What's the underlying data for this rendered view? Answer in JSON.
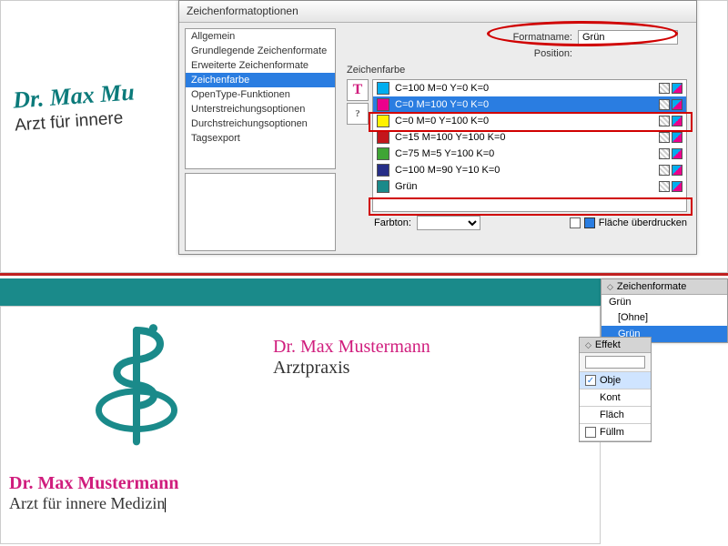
{
  "dialog": {
    "title": "Zeichenformatoptionen",
    "formatname_label": "Formatname:",
    "formatname_value": "Grün",
    "position_label": "Position:",
    "left_items": [
      "Allgemein",
      "Grundlegende Zeichenformate",
      "Erweiterte Zeichenformate",
      "Zeichenfarbe",
      "OpenType-Funktionen",
      "Unterstreichungsoptionen",
      "Durchstreichungsoptionen",
      "Tagsexport"
    ],
    "left_selected_index": 3,
    "right_section_title": "Zeichenfarbe",
    "swatches": [
      {
        "label": "C=100 M=0 Y=0 K=0",
        "color": "#00aeef"
      },
      {
        "label": "C=0 M=100 Y=0 K=0",
        "color": "#ec008c"
      },
      {
        "label": "C=0 M=0 Y=100 K=0",
        "color": "#fff200"
      },
      {
        "label": "C=15 M=100 Y=100 K=0",
        "color": "#c4161c"
      },
      {
        "label": "C=75 M=5 Y=100 K=0",
        "color": "#3fa535"
      },
      {
        "label": "C=100 M=90 Y=10 K=0",
        "color": "#262e87"
      },
      {
        "label": "Grün",
        "color": "#1a8a8a"
      }
    ],
    "swatch_selected_index": 1,
    "farbton_label": "Farbton:",
    "ueberdrucken_label": "Fläche überdrucken"
  },
  "panels": {
    "zeichenformate": {
      "tab": "Zeichenformate",
      "current": "Grün",
      "items": [
        "[Ohne]",
        "Grün"
      ],
      "selected_index": 1
    },
    "effekte": {
      "tab": "Effekt",
      "rows": [
        "Obje",
        "Kont",
        "Fläch",
        "Füllm"
      ]
    }
  },
  "doc": {
    "top_name": "Dr. Max Mu",
    "top_sub": "Arzt für innere",
    "praxis_title": "Dr. Max Mustermann",
    "praxis_sub": "Arztpraxis",
    "bottom_title": "Dr. Max Mustermann",
    "bottom_sub": "Arzt für innere Medizin"
  },
  "icons": {
    "T": "T",
    "q": "?"
  }
}
